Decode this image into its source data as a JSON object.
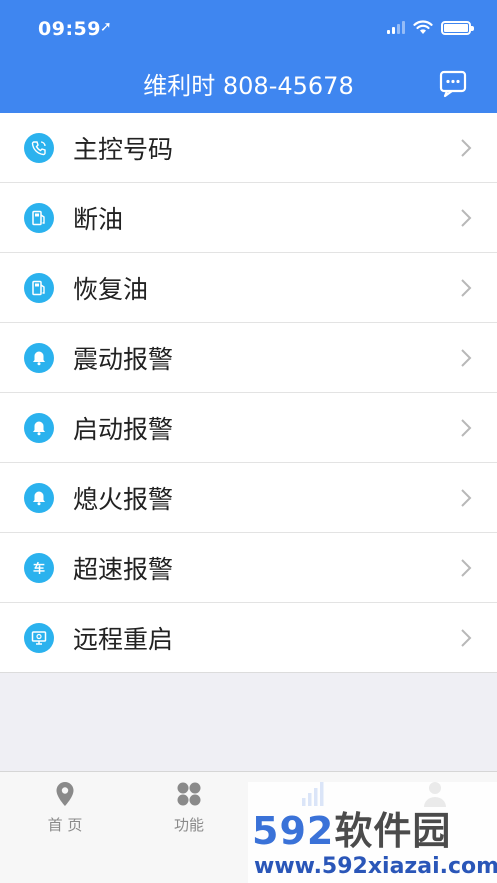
{
  "status_bar": {
    "time": "09:59",
    "location_glyph": "➚"
  },
  "header": {
    "title": "维利时 808-45678",
    "message_icon": "chat-bubble-icon"
  },
  "menu": {
    "items": [
      {
        "label": "主控号码",
        "icon": "phone-call-icon"
      },
      {
        "label": "断油",
        "icon": "fuel-pump-icon"
      },
      {
        "label": "恢复油",
        "icon": "fuel-pump-icon"
      },
      {
        "label": "震动报警",
        "icon": "bell-icon"
      },
      {
        "label": "启动报警",
        "icon": "bell-icon"
      },
      {
        "label": "熄火报警",
        "icon": "bell-icon"
      },
      {
        "label": "超速报警",
        "icon": "car-speed-icon"
      },
      {
        "label": "远程重启",
        "icon": "monitor-restart-icon"
      }
    ]
  },
  "tabbar": {
    "tabs": [
      {
        "label": "首 页",
        "icon": "location-pin-icon"
      },
      {
        "label": "功能",
        "icon": "grid-icon"
      },
      {
        "label": "",
        "icon": "bar-chart-icon"
      },
      {
        "label": "",
        "icon": "person-icon"
      }
    ]
  },
  "watermark": {
    "brand_num": "592",
    "brand_text": "软件园",
    "url": "www.592xiazai.com"
  },
  "colors": {
    "header": "#3f86f0",
    "icon_bg": "#2bb2ee",
    "active_tab": "#3a72d8"
  }
}
